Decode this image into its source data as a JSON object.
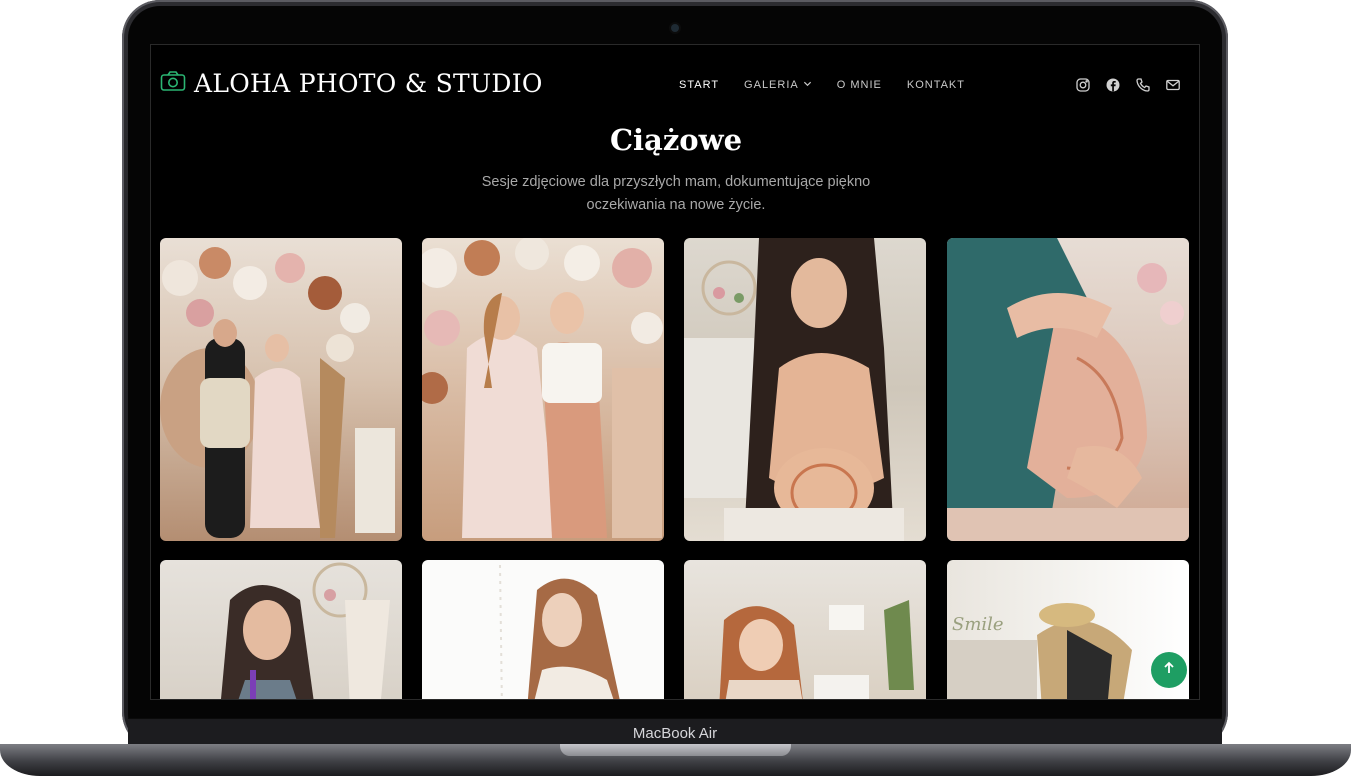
{
  "device": {
    "model_label": "MacBook Air"
  },
  "site": {
    "brand": "ALOHA PHOTO & STUDIO",
    "accent_color": "#2bb673",
    "nav": [
      {
        "label": "START",
        "active": true
      },
      {
        "label": "GALERIA",
        "has_dropdown": true
      },
      {
        "label": "O MNIE"
      },
      {
        "label": "KONTAKT"
      }
    ],
    "social_icons": [
      "instagram-icon",
      "facebook-icon",
      "phone-icon",
      "envelope-icon"
    ]
  },
  "page": {
    "title": "Ciążowe",
    "subtitle": "Sesje zdjęciowe dla przyszłych mam, dokumentujące piękno oczekiwania na nowe życie."
  },
  "gallery": {
    "photos": [
      {
        "name": "couple-balloons-photo"
      },
      {
        "name": "two-women-balloons-photo"
      },
      {
        "name": "bare-belly-henna-photo"
      },
      {
        "name": "lace-dress-belly-photo"
      },
      {
        "name": "smiling-woman-photo"
      },
      {
        "name": "profile-woman-white-photo"
      },
      {
        "name": "redhead-woman-photo"
      },
      {
        "name": "hat-woman-chair-photo"
      }
    ]
  },
  "back_to_top": {
    "icon": "arrow-up-icon"
  }
}
